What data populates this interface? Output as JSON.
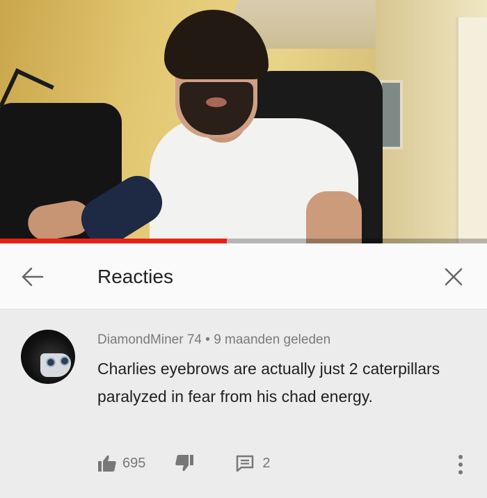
{
  "video": {
    "progress_fraction": 0.465,
    "progress_color": "#e62117"
  },
  "header": {
    "back_icon": "arrow-left-icon",
    "title": "Reacties",
    "close_icon": "close-icon"
  },
  "comment": {
    "author": "DiamondMiner 74",
    "separator": " • ",
    "time": "9 maanden geleden",
    "text": "Charlies eyebrows are actually just 2 caterpillars paralyzed in fear from his chad energy.",
    "likes": "695",
    "replies": "2",
    "like_icon": "thumbs-up-icon",
    "dislike_icon": "thumbs-down-icon",
    "reply_icon": "reply-icon",
    "more_icon": "more-vertical-icon"
  }
}
